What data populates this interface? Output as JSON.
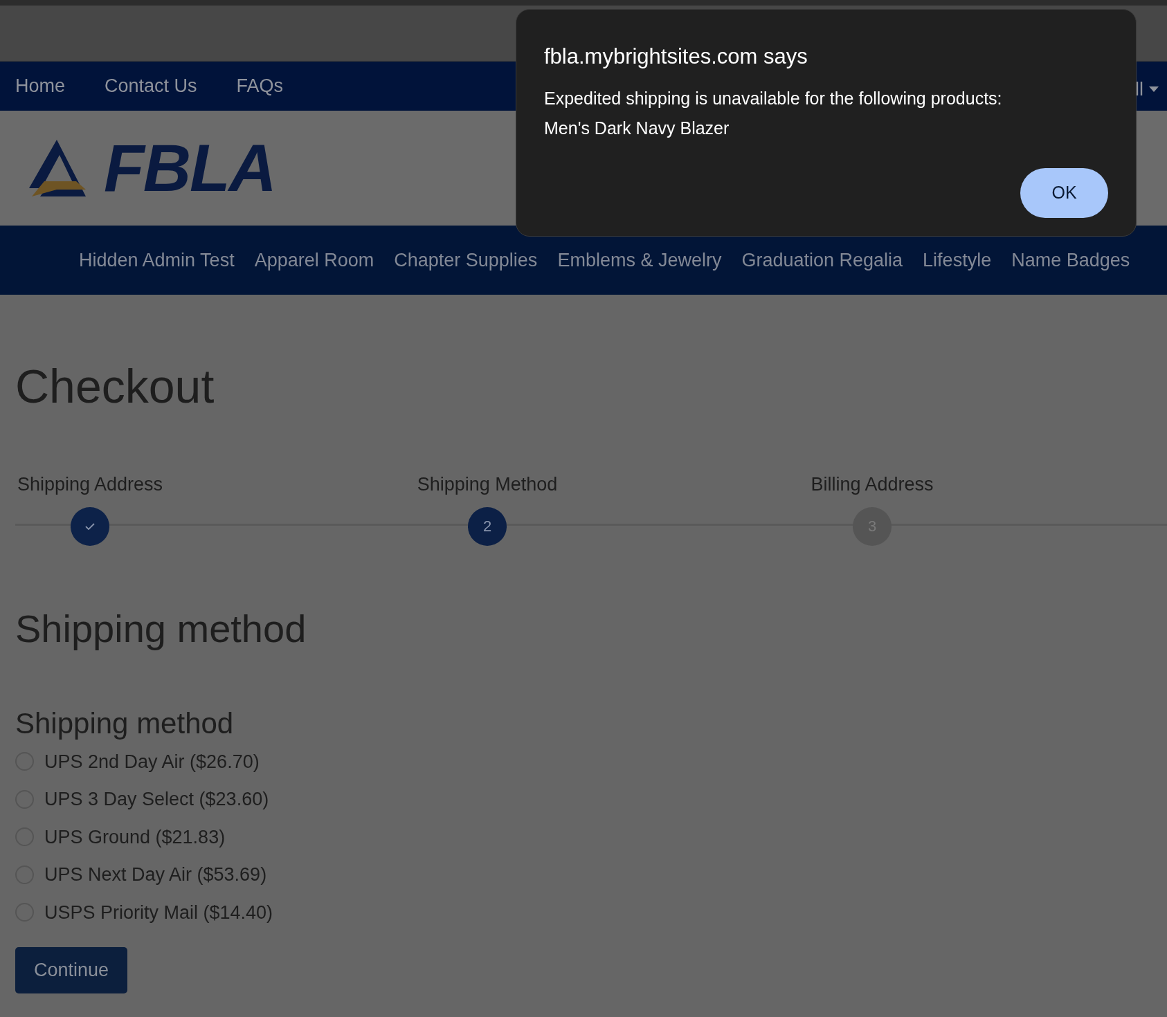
{
  "top_nav": {
    "links": [
      "Home",
      "Contact Us",
      "FAQs"
    ],
    "cut_menu": "ll"
  },
  "logo": {
    "text": "FBLA"
  },
  "categories": [
    "Hidden Admin Test",
    "Apparel Room",
    "Chapter Supplies",
    "Emblems & Jewelry",
    "Graduation Regalia",
    "Lifestyle",
    "Name Badges"
  ],
  "page_title": "Checkout",
  "steps": [
    {
      "label": "Shipping Address",
      "completed": true,
      "selected": false
    },
    {
      "label": "Shipping Method",
      "completed": false,
      "selected": true,
      "number": "2"
    },
    {
      "label": "Billing Address",
      "completed": false,
      "selected": false,
      "number": "3"
    }
  ],
  "section_title": "Shipping method",
  "shipping": {
    "title": "Shipping method",
    "options": [
      {
        "label": "UPS 2nd Day Air ($26.70)",
        "selected": false
      },
      {
        "label": "UPS 3 Day Select ($23.60)",
        "selected": false
      },
      {
        "label": "UPS Ground ($21.83)",
        "selected": false
      },
      {
        "label": "UPS Next Day Air ($53.69)",
        "selected": false
      },
      {
        "label": "USPS Priority Mail ($14.40)",
        "selected": false
      }
    ],
    "button": "Continue"
  },
  "dialog": {
    "title": "fbla.mybrightsites.com says",
    "message_lines": [
      "Expedited shipping is unavailable for the following products:",
      "Men's Dark Navy Blazer"
    ],
    "button": "OK"
  }
}
